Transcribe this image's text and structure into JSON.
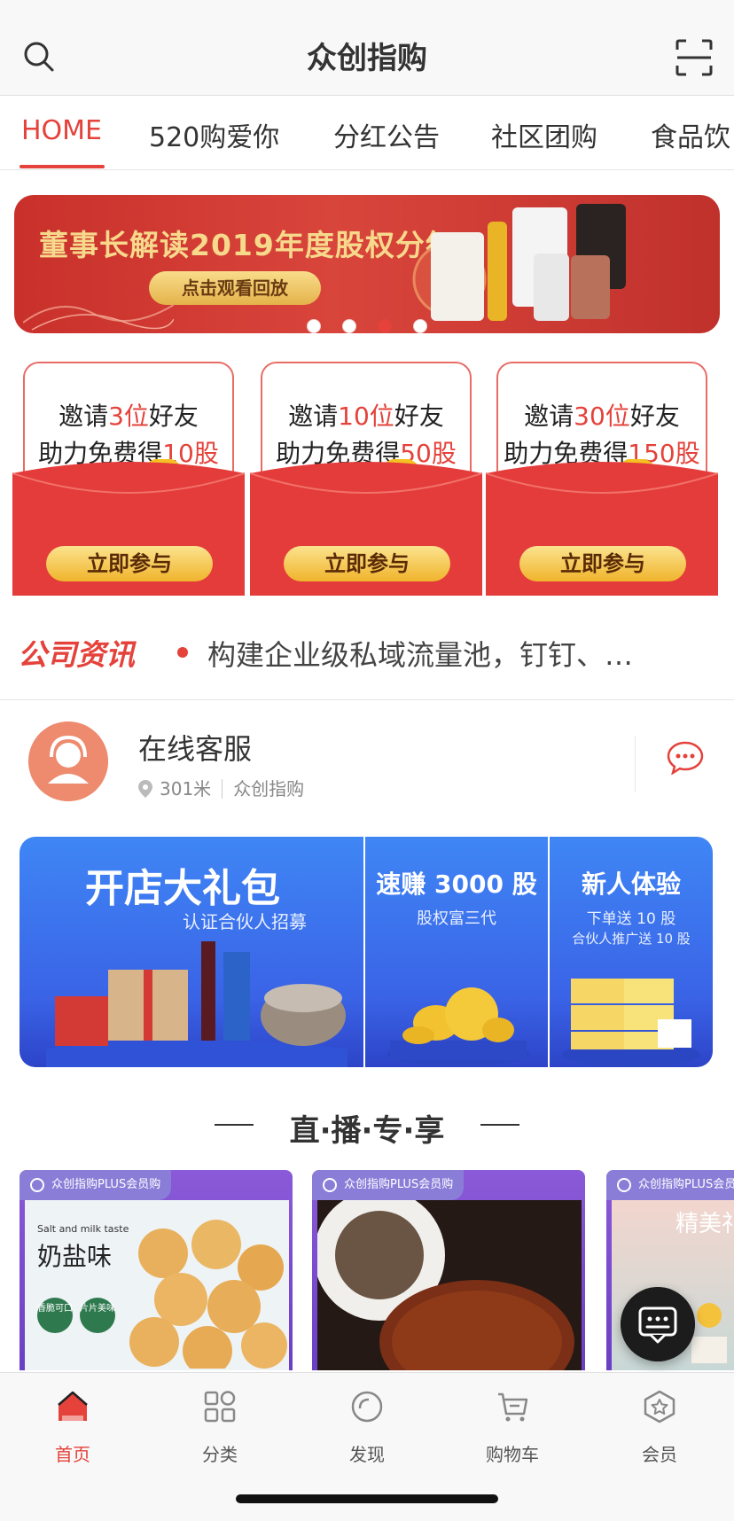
{
  "header": {
    "title": "众创指购"
  },
  "tabs": [
    "HOME",
    "520购爱你",
    "分红公告",
    "社区团购",
    "食品饮"
  ],
  "banner": {
    "title": "董事长解读2019年度股权分红",
    "button": "点击观看回放",
    "slide_count": 4,
    "active_slide": 3
  },
  "invites": [
    {
      "pre": "邀请",
      "count": "3位",
      "post": "好友",
      "line2_pre": "助力免费得",
      "shares": "10股",
      "button": "立即参与"
    },
    {
      "pre": "邀请",
      "count": "10位",
      "post": "好友",
      "line2_pre": "助力免费得",
      "shares": "50股",
      "button": "立即参与"
    },
    {
      "pre": "邀请",
      "count": "30位",
      "post": "好友",
      "line2_pre": "助力免费得",
      "shares": "150股",
      "button": "立即参与"
    }
  ],
  "news": {
    "label": "公司资讯",
    "text": "构建企业级私域流量池，钉钉、…"
  },
  "service": {
    "name": "在线客服",
    "distance": "301米",
    "store": "众创指购"
  },
  "promos": [
    {
      "title": "开店大礼包",
      "subtitle": "认证合伙人招募"
    },
    {
      "title": "速赚 3000 股",
      "subtitle": "股权富三代"
    },
    {
      "title": "新人体验",
      "subtitle": "下单送 10 股",
      "subtitle2": "合伙人推广送 10 股"
    }
  ],
  "section": {
    "title": "直·播·专·享"
  },
  "products": [
    {
      "badge": "众创指购PLUS会员购",
      "small": "Salt and milk taste",
      "big": "奶盐味",
      "tag1": "香脆可口",
      "tag2": "片片美味"
    },
    {
      "badge": "众创指购PLUS会员购"
    },
    {
      "badge": "众创指购PLUS会员",
      "big": "精美礼"
    }
  ],
  "bottom_nav": [
    {
      "label": "首页",
      "icon": "home-icon",
      "active": true
    },
    {
      "label": "分类",
      "icon": "category-icon",
      "active": false
    },
    {
      "label": "发现",
      "icon": "discover-icon",
      "active": false
    },
    {
      "label": "购物车",
      "icon": "cart-icon",
      "active": false
    },
    {
      "label": "会员",
      "icon": "member-star-icon",
      "active": false
    }
  ],
  "colors": {
    "accent": "#e4423a",
    "banner_red": "#c9302b",
    "gold": "#f0b42c",
    "promo_blue": "#3d6ef0"
  }
}
